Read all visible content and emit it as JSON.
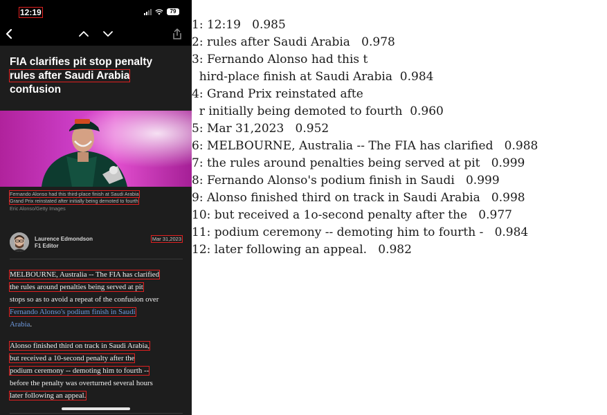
{
  "status_bar": {
    "time": "12:19",
    "battery": "79",
    "icons": [
      "signal-icon",
      "wifi-icon",
      "battery-icon"
    ]
  },
  "nav": {
    "icons": [
      "back-chevron-icon",
      "previous-article-icon",
      "next-article-icon",
      "share-icon"
    ]
  },
  "article": {
    "headline_lines": [
      "FIA clarifies pit stop penalty",
      "rules after Saudi Arabia",
      "confusion"
    ],
    "caption_lines": [
      "Fernando Alonso had this third-place finish at Saudi Arabia",
      "Grand Prix reinstated after initially being demoted to fourth"
    ],
    "photo_credit": "Eric Alonso/Getty Images",
    "author": {
      "name": "Laurence Edmondson",
      "role": "F1 Editor"
    },
    "date": "Mar 31,2023",
    "paragraph1": {
      "line1": "MELBOURNE, Australia -- The FIA has clarified",
      "line2": "the rules around penalties being served at pit",
      "line3": "stops so as to avoid a repeat of the confusion over",
      "link_line1": "Fernando Alonso's podium finish in Saudi",
      "link_line2": "Arabia",
      "end_punct": "."
    },
    "paragraph2": [
      "Alonso finished third on track in Saudi Arabia,",
      "but received a 10-second penalty after the",
      "podium ceremony -- demoting him to fourth --",
      "before the penalty was overturned several hours",
      "later following an appeal."
    ]
  },
  "ocr_results": [
    "1: 12:19   0.985",
    "2: rules after Saudi Arabia   0.978",
    "3: Fernando Alonso had this t",
    "  hird-place finish at Saudi Arabia  0.984",
    "4: Grand Prix reinstated afte",
    "  r initially being demoted to fourth  0.960",
    "5: Mar 31,2023   0.952",
    "6: MELBOURNE, Australia -- The FIA has clarified   0.988",
    "7: the rules around penalties being served at pit   0.999",
    "8: Fernando Alonso's podium finish in Saudi   0.999",
    "9: Alonso finished third on track in Saudi Arabia   0.998",
    "10: but received a 1o-second penalty after the   0.977",
    "11: podium ceremony -- demoting him to fourth -   0.984",
    "12: later following an appeal.   0.982"
  ],
  "colors": {
    "detection_box": "#e02020",
    "page_background": "#1d1d1d",
    "link": "#6f9be0"
  }
}
